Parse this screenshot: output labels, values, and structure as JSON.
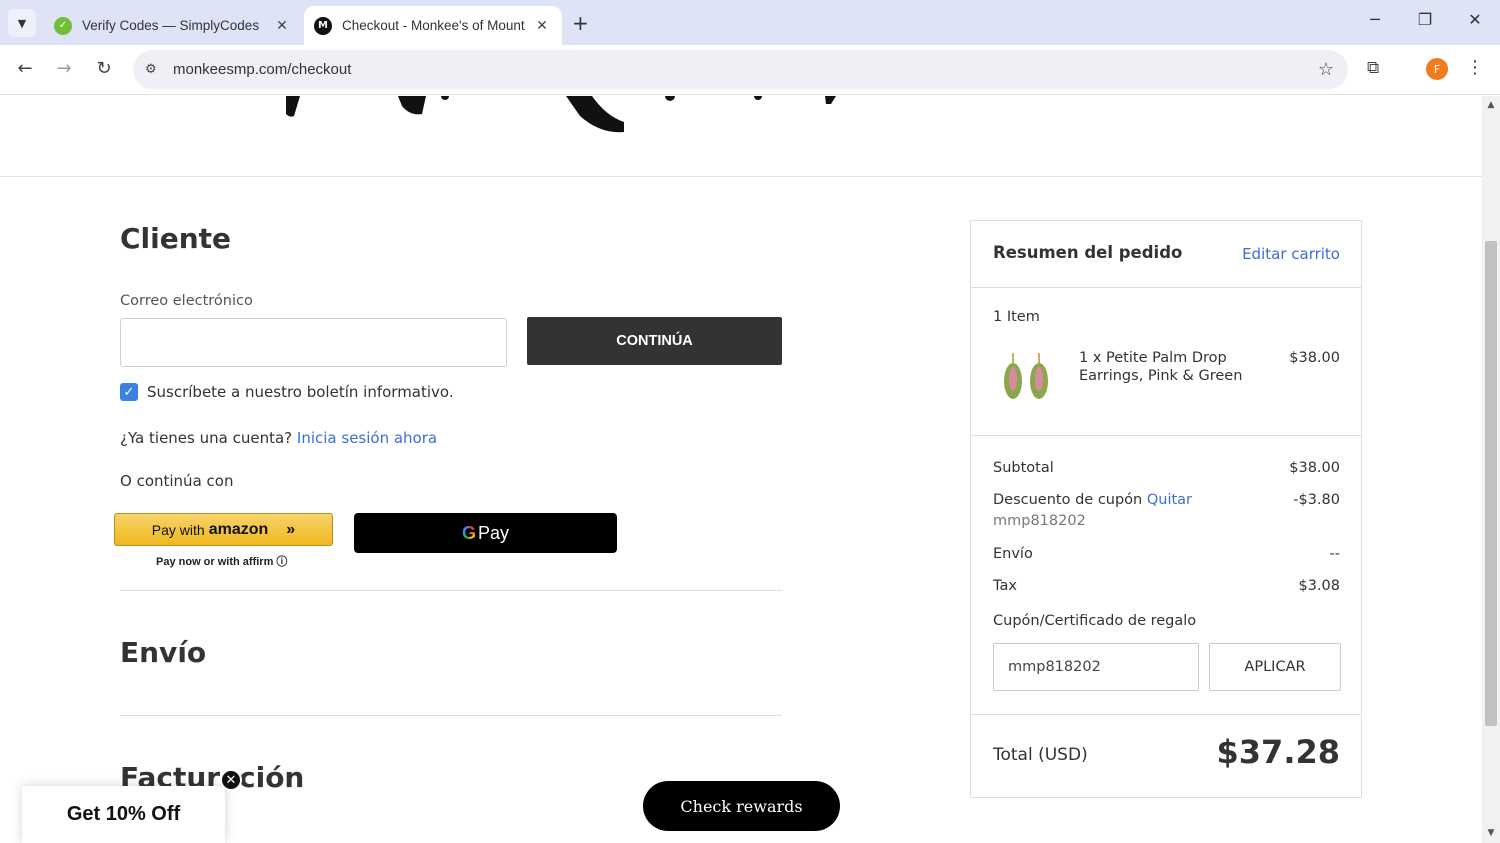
{
  "browser": {
    "tabs": [
      {
        "title": "Verify Codes — SimplyCodes",
        "favicon": "simplycodes-icon",
        "active": false
      },
      {
        "title": "Checkout - Monkee's of Mount",
        "favicon": "monkees-m-icon",
        "active": true
      }
    ],
    "url": "monkeesmp.com/checkout",
    "profile_initial": "F"
  },
  "customer": {
    "title": "Cliente",
    "email_label": "Correo electrónico",
    "email_value": "",
    "continue_label": "CONTINÚA",
    "newsletter_label": "Suscríbete a nuestro boletín informativo.",
    "newsletter_checked": true,
    "account_prompt": "¿Ya tienes una cuenta?",
    "signin_link": "Inicia sesión ahora",
    "or_continue": "O continúa con",
    "amazon_prefix": "Pay with",
    "amazon_brand": "amazon",
    "affirm_note": "Pay now or with affirm",
    "gpay_label": "Pay"
  },
  "shipping": {
    "title": "Envío"
  },
  "billing": {
    "title": "Facturación"
  },
  "summary": {
    "title": "Resumen del pedido",
    "edit_cart": "Editar carrito",
    "item_count": "1 Item",
    "item": {
      "name": "1 x Petite Palm Drop Earrings, Pink & Green",
      "price": "$38.00"
    },
    "subtotal_label": "Subtotal",
    "subtotal_value": "$38.00",
    "discount_label": "Descuento de cupón",
    "discount_remove": "Quitar",
    "discount_code": "mmp818202",
    "discount_value": "-$3.80",
    "shipping_label": "Envío",
    "shipping_value": "--",
    "tax_label": "Tax",
    "tax_value": "$3.08",
    "coupon_label": "Cupón/Certificado de regalo",
    "coupon_value": "mmp818202",
    "apply_label": "APLICAR",
    "total_label": "Total (USD)",
    "total_value": "$37.28"
  },
  "overlays": {
    "promo_text": "Get 10% Off",
    "rewards_label": "Check rewards"
  },
  "colors": {
    "link": "#3b6fd4",
    "checkbox": "#3b82e0",
    "button_dark": "#333333"
  }
}
